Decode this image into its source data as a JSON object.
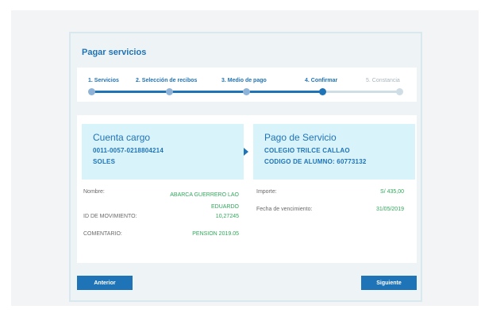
{
  "page": {
    "title": "Pagar servicios"
  },
  "stepper": {
    "steps": [
      {
        "label": "1. Servicios",
        "state": "done"
      },
      {
        "label": "2. Selección de recibos",
        "state": "done"
      },
      {
        "label": "3. Medio de pago",
        "state": "done"
      },
      {
        "label": "4. Confirmar",
        "state": "current"
      },
      {
        "label": "5. Constancia",
        "state": "pending"
      }
    ]
  },
  "cuenta": {
    "heading": "Cuenta cargo",
    "number": "0011-0057-0218804214",
    "currency": "SOLES"
  },
  "pago": {
    "heading": "Pago de Servicio",
    "company": "COLEGIO TRILCE CALLAO",
    "code": "CODIGO DE ALUMNO: 60773132"
  },
  "details": {
    "nombre_label": "Nombre:",
    "nombre_value": "ABARCA GUERRERO LAO EDUARDO",
    "movimiento_label": "ID DE MOVIMIENTO:",
    "movimiento_value": "10,27245",
    "comentario_label": "COMENTARIO:",
    "comentario_value": "PENSION 2019.05",
    "importe_label": "Importe:",
    "importe_value": "S/ 435,00",
    "vencimiento_label": "Fecha de vencimiento:",
    "vencimiento_value": "31/05/2019"
  },
  "buttons": {
    "anterior": "Anterior",
    "siguiente": "Siguiente"
  },
  "colors": {
    "primary": "#1f73b7",
    "value_green": "#2fa85a",
    "box_bg": "#d9f3fa"
  }
}
